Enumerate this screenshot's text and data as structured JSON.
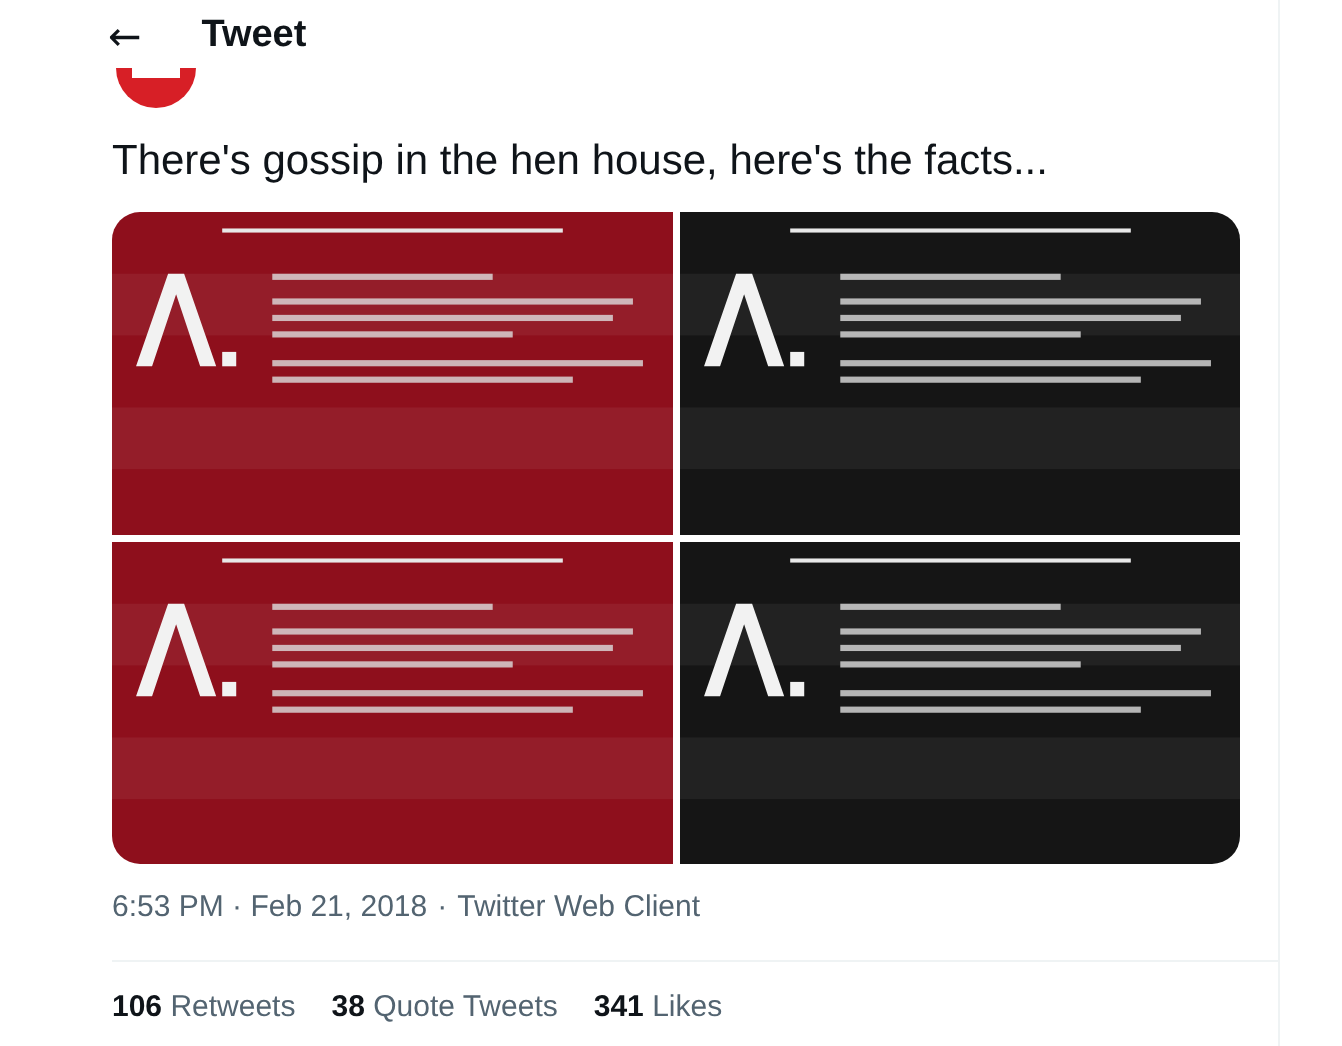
{
  "header": {
    "back_icon": "←",
    "title": "Tweet"
  },
  "tweet": {
    "text": "There's gossip in the hen house, here's the facts...",
    "meta": {
      "timestamp": "6:53 PM · Feb 21, 2018",
      "separator": "·",
      "source": "Twitter Web Client"
    },
    "stats": [
      {
        "count": "106",
        "label": "Retweets"
      },
      {
        "count": "38",
        "label": "Quote Tweets"
      },
      {
        "count": "341",
        "label": "Likes"
      }
    ]
  }
}
